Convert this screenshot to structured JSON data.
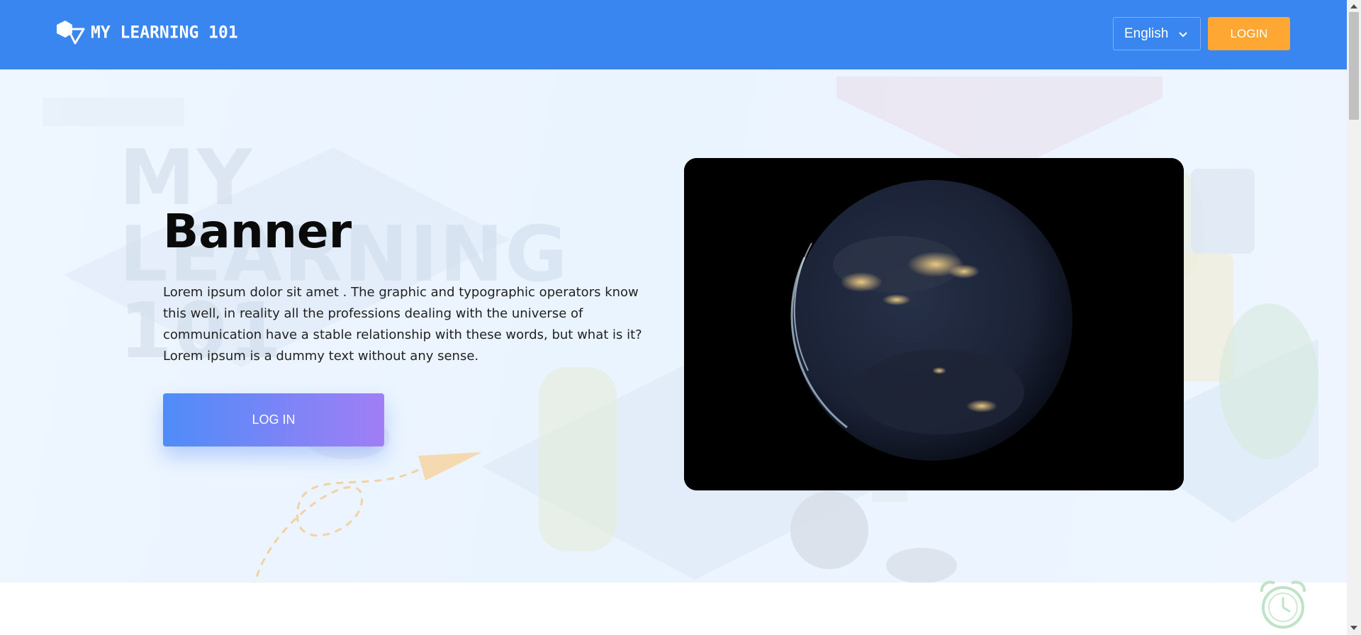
{
  "header": {
    "logo_text": "MY LEARNING 101",
    "language": "English",
    "login_label": "LOGIN",
    "colors": {
      "bar": "#3a86f0",
      "login": "#ffa733"
    }
  },
  "hero": {
    "watermark": [
      "MY",
      "LEARNING",
      "101"
    ],
    "title": "Banner",
    "description": "Lorem ipsum dolor sit amet . The graphic and typographic operators know this well, in reality all the professions dealing with the universe of communication have a stable relationship with these words, but what is it? Lorem ipsum is a dummy text without any sense.",
    "login_button_label": "LOG IN",
    "media": "earth-at-night-video"
  },
  "icons": {
    "logo": "logo-icon",
    "language_chevron": "chevron-down-icon",
    "alarm": "alarm-clock-icon"
  }
}
